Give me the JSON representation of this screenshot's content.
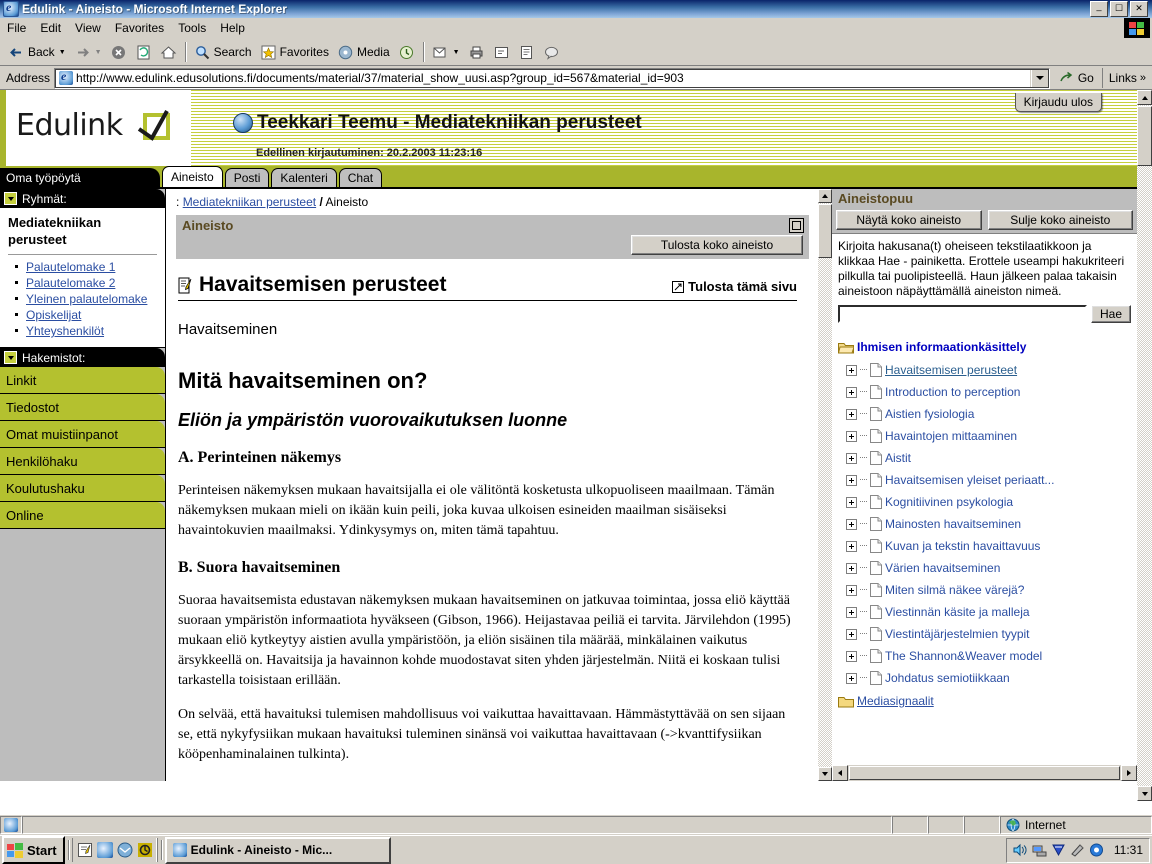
{
  "window": {
    "title": "Edulink - Aineisto - Microsoft Internet Explorer",
    "icon": "ie-icon",
    "minimize": "_",
    "maximize": "▣",
    "close": "✕"
  },
  "menu": [
    "File",
    "Edit",
    "View",
    "Favorites",
    "Tools",
    "Help"
  ],
  "toolbar": {
    "back": "Back",
    "forward": "",
    "stop": "stop-icon",
    "refresh": "refresh-icon",
    "home": "home-icon",
    "search": "Search",
    "favorites": "Favorites",
    "media": "Media",
    "history": "history-icon",
    "mail": "mail-icon",
    "print": "print-icon",
    "edit": "edit-icon",
    "discuss": "discuss-icon",
    "messenger": "messenger-icon"
  },
  "address": {
    "label": "Address",
    "url": "http://www.edulink.edusolutions.fi/documents/material/37/material_show_uusi.asp?group_id=567&material_id=903",
    "go": "Go",
    "links": "Links"
  },
  "banner": {
    "brand": "Edulink",
    "user_title": "Teekkari Teemu - Mediatekniikan perusteet",
    "last_login": "Edellinen kirjautuminen: 20.2.2003 11:23:16",
    "logout": "Kirjaudu ulos"
  },
  "tabs": {
    "left_caption": "Oma työpöytä",
    "items": [
      {
        "label": "Aineisto",
        "active": true
      },
      {
        "label": "Posti",
        "active": false
      },
      {
        "label": "Kalenteri",
        "active": false
      },
      {
        "label": "Chat",
        "active": false
      }
    ]
  },
  "sidebar": {
    "groups_header": "Ryhmät:",
    "group_title": "Mediatekniikan perusteet",
    "group_links": [
      "Palautelomake 1",
      "Palautelomake 2",
      "Yleinen palautelomake",
      "Opiskelijat",
      "Yhteyshenkilöt"
    ],
    "directories_header": "Hakemistot:",
    "directories": [
      "Linkit",
      "Tiedostot",
      "Omat muistiinpanot",
      "Henkilöhaku",
      "Koulutushaku",
      "Online"
    ]
  },
  "content": {
    "breadcrumb_prefix": ":",
    "breadcrumb_link": "Mediatekniikan perusteet",
    "breadcrumb_sep": "/",
    "breadcrumb_current": "Aineisto",
    "panel_title": "Aineisto",
    "print_all_button": "Tulosta koko aineisto",
    "article_title": "Havaitsemisen perusteet",
    "print_page_link": "Tulosta tämä sivu",
    "subtitle": "Havaitseminen",
    "heading1": "Mitä havaitseminen on?",
    "heading2": "Eliön ja ympäristön vuorovaikutuksen luonne",
    "heading_a": "A. Perinteinen näkemys",
    "para_a": "Perinteisen näkemyksen mukaan havaitsijalla ei ole välitöntä kosketusta ulkopuoliseen maailmaan. Tämän näkemyksen mukaan mieli on ikään kuin peili, joka kuvaa ulkoisen esineiden maailman sisäiseksi havaintokuvien maailmaksi. Ydinkysymys on, miten tämä tapahtuu.",
    "heading_b": "B. Suora havaitseminen",
    "para_b1": "Suoraa havaitsemista edustavan näkemyksen mukaan havaitseminen on jatkuvaa toimintaa, jossa eliö käyttää suoraan ympäristön informaatiota hyväkseen (Gibson, 1966). Heijastavaa peiliä ei tarvita. Järvilehdon (1995) mukaan eliö kytkeytyy aistien avulla ympäristöön, ja eliön sisäinen tila määrää, minkälainen vaikutus ärsykkeellä on. Havaitsija ja havainnon kohde muodostavat siten yhden järjestelmän. Niitä ei koskaan tulisi tarkastella toisistaan erillään.",
    "para_b2": "On selvää, että havaituksi tulemisen mahdollisuus voi vaikuttaa havaittavaan. Hämmästyttävää on sen sijaan se, että nykyfysiikan mukaan havaituksi tuleminen sinänsä voi vaikuttaa havaittavaan (->kvanttifysiikan kööpenhaminalainen tulkinta)."
  },
  "tree_panel": {
    "title": "Aineistopuu",
    "show_all_button": "Näytä koko aineisto",
    "close_all_button": "Sulje koko aineisto",
    "help_text": "Kirjoita hakusana(t) oheiseen tekstilaatikkoon ja klikkaa Hae - painiketta. Erottele useampi hakukriteeri pilkulla tai puolipisteellä. Haun jälkeen palaa takaisin aineistoon näpäyttämällä aineiston nimeä.",
    "search_value": "",
    "search_button": "Hae",
    "root": "Ihmisen informaationkäsittely",
    "items": [
      "Havaitsemisen perusteet",
      "Introduction to perception",
      "Aistien fysiologia",
      "Havaintojen mittaaminen",
      "Aistit",
      "Havaitsemisen yleiset periaatt...",
      "Kognitiivinen psykologia",
      "Mainosten havaitseminen",
      "Kuvan ja tekstin havaittavuus",
      "Värien havaitseminen",
      "Miten silmä näkee värejä?",
      "Viestinnän käsite ja malleja",
      "Viestintäjärjestelmien tyypit",
      "The Shannon&Weaver model",
      "Johdatus semiotiikkaan"
    ],
    "second_root": "Mediasignaalit"
  },
  "status": {
    "zone": "Internet",
    "zone_icon": "globe-icon"
  },
  "taskbar": {
    "start": "Start",
    "quick_launch": [
      "show-desktop-icon",
      "ie-icon",
      "outlook-icon",
      "norton-icon"
    ],
    "task_button": "Edulink - Aineisto - Mic...",
    "tray_icons": [
      "volume-icon",
      "network-icon",
      "antivirus-icon",
      "defrag-icon",
      "messenger-icon"
    ],
    "clock": "11:31"
  },
  "colors": {
    "brand_green": "#b4c12f",
    "accent_green": "#c5cf3e",
    "link_blue": "#2b4ea2",
    "panel_gray": "#bdbdbd",
    "chrome_gray": "#d4d0c8",
    "title_blue": "#0a246a"
  }
}
